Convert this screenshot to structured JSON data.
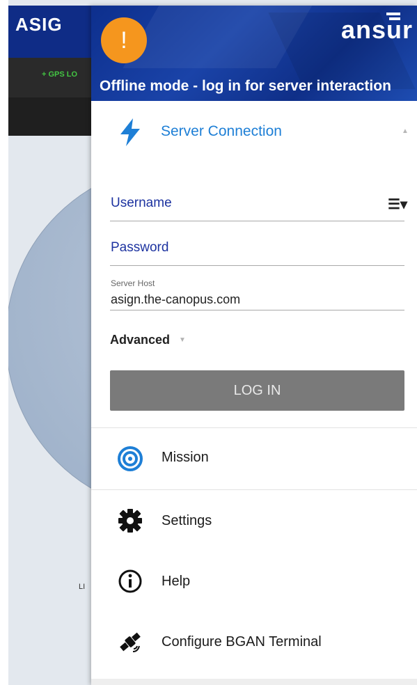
{
  "background": {
    "logo_text": "ASIG",
    "gps_label": "+ GPS LO",
    "live_label": "LI"
  },
  "drawer": {
    "alert_symbol": "!",
    "brand_logo": "ansur",
    "offline_banner": "Offline mode - log in for server interaction",
    "server_section": {
      "title": "Server Connection",
      "collapse_arrow": "▲",
      "username_label": "Username",
      "user_menu_icon": "☰▾",
      "password_label": "Password",
      "host_label": "Server Host",
      "host_value": "asign.the-canopus.com",
      "advanced_label": "Advanced",
      "advanced_arrow": "▼",
      "login_label": "LOG IN"
    },
    "menu": [
      {
        "label": "Mission",
        "icon": "target-icon"
      },
      {
        "label": "Settings",
        "icon": "gear-icon"
      },
      {
        "label": "Help",
        "icon": "info-icon"
      },
      {
        "label": "Configure BGAN Terminal",
        "icon": "satellite-icon"
      }
    ]
  },
  "colors": {
    "header_blue": "#0d2f8d",
    "accent_blue": "#1e7fd6",
    "alert_orange": "#f5961e",
    "button_gray": "#7a7a7a"
  }
}
